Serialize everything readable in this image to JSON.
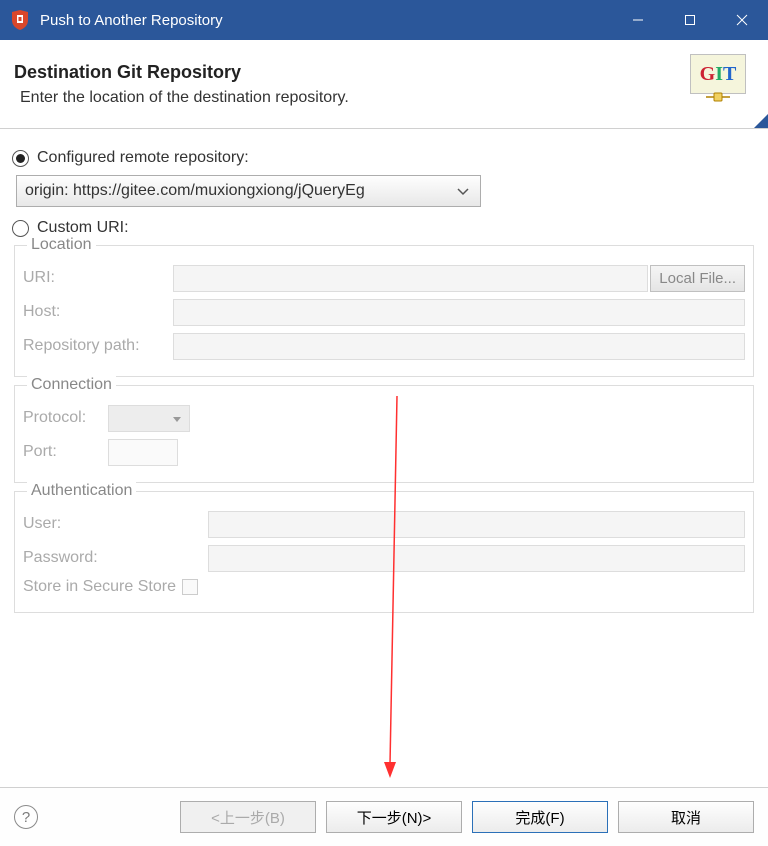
{
  "window": {
    "title": "Push to Another Repository"
  },
  "header": {
    "title": "Destination Git Repository",
    "subtitle": "Enter the location of the destination repository."
  },
  "radios": {
    "configured_label": "Configured remote repository:",
    "custom_label": "Custom URI:",
    "selected": "configured"
  },
  "combo": {
    "value": "origin: https://gitee.com/muxiongxiong/jQueryEg"
  },
  "location": {
    "legend": "Location",
    "uri_label": "URI:",
    "uri_value": "",
    "local_file_btn": "Local File...",
    "host_label": "Host:",
    "host_value": "",
    "repo_path_label": "Repository path:",
    "repo_path_value": ""
  },
  "connection": {
    "legend": "Connection",
    "protocol_label": "Protocol:",
    "protocol_value": "",
    "port_label": "Port:",
    "port_value": ""
  },
  "auth": {
    "legend": "Authentication",
    "user_label": "User:",
    "user_value": "",
    "password_label": "Password:",
    "password_value": "",
    "store_label": "Store in Secure Store"
  },
  "footer": {
    "help": "?",
    "back": "<上一步(B)",
    "next": "下一步(N)>",
    "finish": "完成(F)",
    "cancel": "取消"
  }
}
